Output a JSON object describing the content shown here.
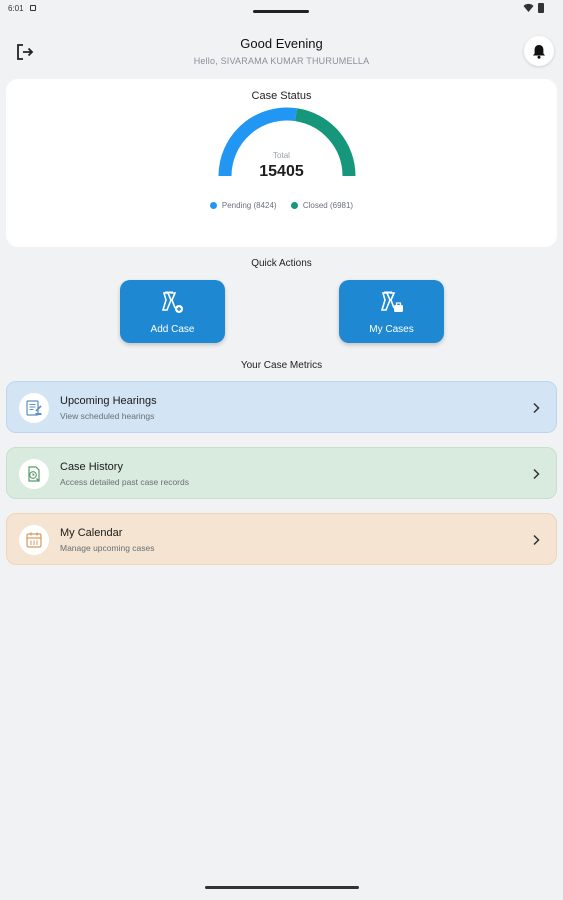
{
  "status_bar": {
    "time": "6:01"
  },
  "header": {
    "greeting": "Good Evening",
    "hello": "Hello, SIVARAMA KUMAR THURUMELLA",
    "logout_icon": "logout-icon",
    "bell_icon": "bell-icon"
  },
  "case_status": {
    "title": "Case Status",
    "total_label": "Total",
    "total_value": "15405",
    "legend": [
      {
        "label": "Pending (8424)",
        "color": "#2196f3"
      },
      {
        "label": "Closed (6981)",
        "color": "#16967a"
      }
    ],
    "chart_data": {
      "type": "pie",
      "categories": [
        "Pending",
        "Closed"
      ],
      "values": [
        8424,
        6981
      ],
      "colors": [
        "#2196f3",
        "#16967a"
      ]
    }
  },
  "quick_actions": {
    "title": "Quick Actions",
    "buttons": [
      {
        "label": "Add Case",
        "icon": "add-case-icon"
      },
      {
        "label": "My Cases",
        "icon": "my-cases-icon"
      }
    ],
    "color": "#1e88d3"
  },
  "metrics": {
    "title": "Your Case Metrics",
    "items": [
      {
        "title": "Upcoming Hearings",
        "subtitle": "View scheduled hearings",
        "icon": "hearings-icon",
        "color": "#d3e4f5"
      },
      {
        "title": "Case History",
        "subtitle": "Access detailed past case records",
        "icon": "history-icon",
        "color": "#d9eadf"
      },
      {
        "title": "My Calendar",
        "subtitle": "Manage upcoming cases",
        "icon": "calendar-icon",
        "color": "#f4e4d1"
      }
    ]
  }
}
